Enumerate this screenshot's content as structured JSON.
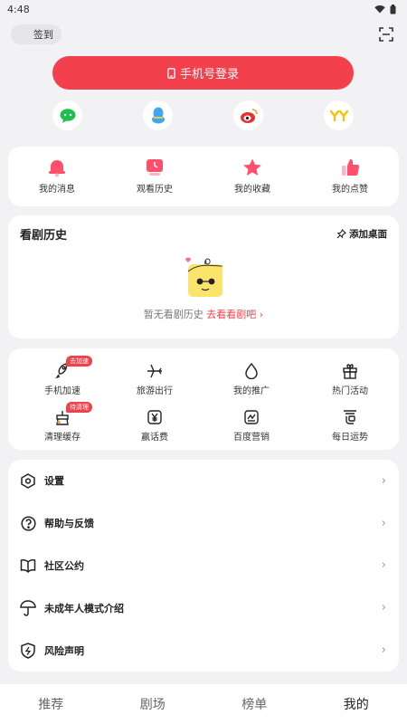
{
  "status": {
    "time": "4:48"
  },
  "top": {
    "signin_label": "签到"
  },
  "login": {
    "label": "手机号登录"
  },
  "third_party": [
    "wechat-icon",
    "qq-icon",
    "weibo-icon",
    "yy-icon"
  ],
  "quick": [
    {
      "label": "我的消息",
      "icon": "bell-icon"
    },
    {
      "label": "观看历史",
      "icon": "history-icon"
    },
    {
      "label": "我的收藏",
      "icon": "star-icon"
    },
    {
      "label": "我的点赞",
      "icon": "thumbs-up-icon"
    }
  ],
  "history": {
    "title": "看剧历史",
    "add_label": "添加桌面",
    "empty_text": "暂无看剧历史",
    "go_link": "去看看剧吧 ›"
  },
  "tools": [
    {
      "label": "手机加速",
      "badge": "去加速",
      "icon": "rocket-icon"
    },
    {
      "label": "旅游出行",
      "badge": "",
      "icon": "plane-icon"
    },
    {
      "label": "我的推广",
      "badge": "",
      "icon": "flame-icon"
    },
    {
      "label": "热门活动",
      "badge": "",
      "icon": "gift-icon"
    },
    {
      "label": "清理缓存",
      "badge": "待清理",
      "icon": "broom-icon"
    },
    {
      "label": "赢话费",
      "badge": "",
      "icon": "yen-icon"
    },
    {
      "label": "百度营销",
      "badge": "",
      "icon": "chart-icon"
    },
    {
      "label": "每日运势",
      "badge": "",
      "icon": "fortune-icon"
    }
  ],
  "settings": [
    {
      "label": "设置",
      "icon": "settings-icon"
    },
    {
      "label": "帮助与反馈",
      "icon": "help-icon"
    },
    {
      "label": "社区公约",
      "icon": "book-icon"
    },
    {
      "label": "未成年人模式介绍",
      "icon": "umbrella-icon"
    },
    {
      "label": "风险声明",
      "icon": "shield-icon"
    }
  ],
  "nav": [
    {
      "label": "推荐",
      "active": false
    },
    {
      "label": "剧场",
      "active": false
    },
    {
      "label": "榜单",
      "active": false
    },
    {
      "label": "我的",
      "active": true
    }
  ],
  "colors": {
    "accent": "#f2404c",
    "background": "#f2f2f4"
  }
}
